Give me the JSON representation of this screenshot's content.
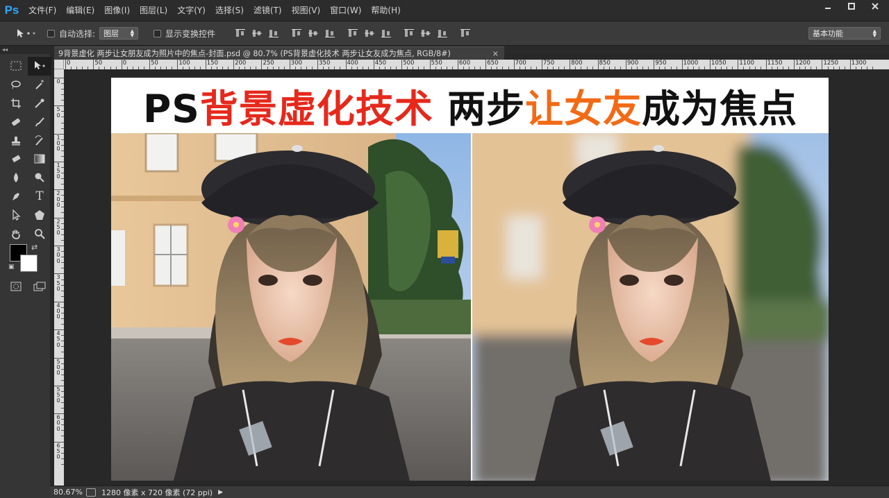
{
  "app": {
    "logo": "Ps",
    "menu": [
      "文件(F)",
      "编辑(E)",
      "图像(I)",
      "图层(L)",
      "文字(Y)",
      "选择(S)",
      "滤镜(T)",
      "视图(V)",
      "窗口(W)",
      "帮助(H)"
    ],
    "window_controls": [
      "minimize-icon",
      "maximize-icon",
      "close-icon"
    ]
  },
  "options": {
    "auto_select_label": "自动选择:",
    "auto_select_value": "图层",
    "show_transform_label": "显示变换控件",
    "workspace": "基本功能"
  },
  "document": {
    "tab_title": "9背景虚化 两步让女朋友成为照片中的焦点-封面.psd @ 80.7% (PS背景虚化技术 两步让女友成为焦点, RGB/8#)",
    "tab_close": "×",
    "ruler_h": [
      "0",
      "50",
      "0",
      "50",
      "100",
      "150",
      "200",
      "250",
      "300",
      "350",
      "400",
      "450",
      "500",
      "550",
      "600",
      "650",
      "700",
      "750",
      "800",
      "850",
      "900",
      "950",
      "1000",
      "1050",
      "1100",
      "1150",
      "1200",
      "1250",
      "1300"
    ],
    "ruler_v": [
      "0",
      "50",
      "100",
      "150",
      "200",
      "250",
      "300",
      "350",
      "400",
      "450",
      "500",
      "550",
      "600",
      "650"
    ]
  },
  "image": {
    "title_parts": [
      {
        "text": "PS",
        "color": "#111111"
      },
      {
        "text": "背景虚化技术",
        "color": "#e5291c"
      },
      {
        "text": " 两步",
        "color": "#111111"
      },
      {
        "text": "让女友",
        "color": "#f26a16"
      },
      {
        "text": "成为焦点",
        "color": "#111111"
      }
    ]
  },
  "status": {
    "zoom": "80.67%",
    "doc_info": "1280 像素 x 720 像素 (72 ppi)",
    "arrow": "▶"
  },
  "tools": [
    "move-tool",
    "artboard-tool",
    "marquee-tool",
    "magic-wand-tool",
    "lasso-tool",
    "quick-selection-tool",
    "crop-tool",
    "eyedropper-tool",
    "healing-brush-tool",
    "brush-tool",
    "stamp-tool",
    "history-brush-tool",
    "eraser-tool",
    "gradient-tool",
    "blur-tool",
    "dodge-tool",
    "pen-tool",
    "type-tool",
    "path-selection-tool",
    "shape-tool",
    "hand-tool",
    "zoom-tool"
  ],
  "colors": {
    "accent": "#31a8ff",
    "title_red": "#e5291c",
    "title_orange": "#f26a16"
  }
}
